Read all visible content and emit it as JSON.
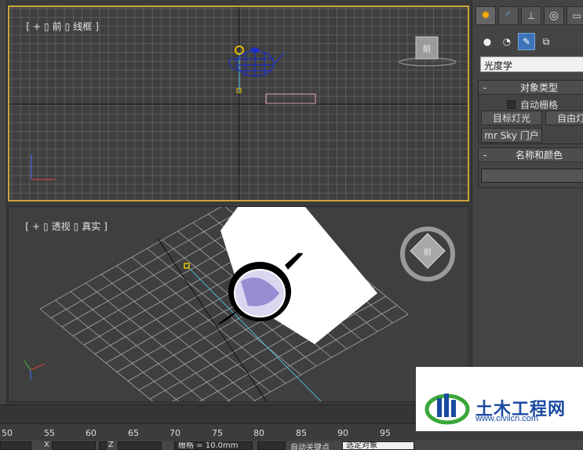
{
  "viewports": {
    "front": {
      "bracket_open": "[",
      "plus": "+",
      "box": "▯",
      "name": "前",
      "box2": "▯",
      "mode": "线框",
      "bracket_close": "]"
    },
    "perspective": {
      "bracket_open": "[",
      "plus": "+",
      "box": "▯",
      "name": "透视",
      "box2": "▯",
      "mode": "真实",
      "bracket_close": "]"
    }
  },
  "viewcube": {
    "front_face": "前"
  },
  "command_panel": {
    "tabs": [
      "create-icon",
      "modify-icon",
      "hierarchy-icon",
      "motion-icon",
      "display-icon"
    ],
    "sub_tabs": [
      "geometry-icon",
      "shapes-icon",
      "lights-icon",
      "cameras-icon"
    ],
    "category": "光度学",
    "object_type": {
      "toggle": "-",
      "title": "对象类型",
      "autogrid_label": "自动栅格",
      "buttons": [
        "目标灯光",
        "自由灯光",
        "mr Sky 门户"
      ]
    },
    "name_color": {
      "toggle": "-",
      "title": "名称和颜色",
      "name_value": ""
    }
  },
  "timeline": {
    "ticks": [
      "50",
      "55",
      "60",
      "65",
      "70",
      "75",
      "80",
      "85",
      "90",
      "95"
    ]
  },
  "status": {
    "x_label": "X",
    "z_label": "Z",
    "grid_text": "栅格 = 10.0mm",
    "auto_key": "自动关键点",
    "selected_objects": "选定对象"
  },
  "watermark": {
    "title": "土木工程网",
    "url": "www.civilcn.com"
  },
  "colors": {
    "active_viewport_border": "#c9a53a",
    "teapot_wire": "#1d2fc4",
    "light_target": "#d4b000",
    "accent": "#3d73b8"
  }
}
